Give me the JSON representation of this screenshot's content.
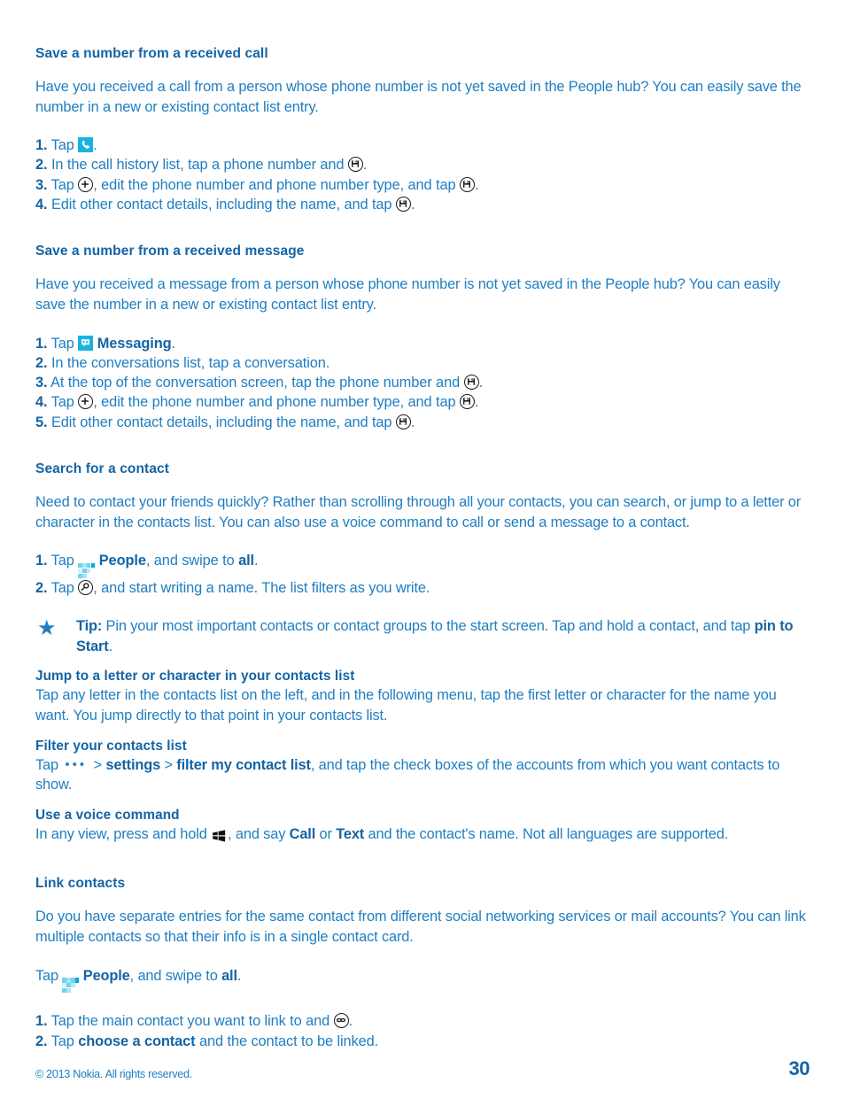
{
  "colors": {
    "heading": "#1464a5",
    "body": "#1f7ec2",
    "tile_cyan": "#16b4e0",
    "icon_outline": "#1a1a1a"
  },
  "sections": {
    "saved_call": {
      "title": "Save a number from a received call",
      "intro": "Have you received a call from a person whose phone number is not yet saved in the People hub? You can easily save the number in a new or existing contact list entry.",
      "steps": [
        {
          "num": "1.",
          "pre": "Tap ",
          "icon": "phone-tile-icon",
          "post": "."
        },
        {
          "num": "2.",
          "pre": "In the call history list, tap a phone number and ",
          "icon": "save-icon",
          "post": "."
        },
        {
          "num": "3.",
          "pre": "Tap ",
          "icon": "plus-icon",
          "mid": ", edit the phone number and phone number type, and tap ",
          "icon2": "save-icon",
          "post": "."
        },
        {
          "num": "4.",
          "pre": "Edit other contact details, including the name, and tap ",
          "icon": "save-icon",
          "post": "."
        }
      ]
    },
    "saved_message": {
      "title": "Save a number from a received message",
      "intro": "Have you received a message from a person whose phone number is not yet saved in the People hub? You can easily save the number in a new or existing contact list entry.",
      "steps": [
        {
          "num": "1.",
          "pre": "Tap ",
          "icon": "messaging-tile-icon",
          "bold": "Messaging",
          "post": "."
        },
        {
          "num": "2.",
          "pre": "In the conversations list, tap a conversation.",
          "post": ""
        },
        {
          "num": "3.",
          "pre": "At the top of the conversation screen, tap the phone number and ",
          "icon": "save-icon",
          "post": "."
        },
        {
          "num": "4.",
          "pre": "Tap ",
          "icon": "plus-icon",
          "mid": ", edit the phone number and phone number type, and tap ",
          "icon2": "save-icon",
          "post": "."
        },
        {
          "num": "5.",
          "pre": "Edit other contact details, including the name, and tap ",
          "icon": "save-icon",
          "post": "."
        }
      ]
    },
    "search_contact": {
      "title": "Search for a contact",
      "intro": "Need to contact your friends quickly? Rather than scrolling through all your contacts, you can search, or jump to a letter or character in the contacts list. You can also use a voice command to call or send a message to a contact.",
      "steps": [
        {
          "num": "1.",
          "pre": "Tap ",
          "icon": "people-tile-icon",
          "bold": "People",
          "mid": ", and swipe to ",
          "bold2": "all",
          "post": "."
        },
        {
          "num": "2.",
          "pre": "Tap ",
          "icon": "search-icon",
          "mid": ", and start writing a name. The list filters as you write.",
          "post": ""
        }
      ],
      "tip": {
        "label": "Tip:",
        "text_before": " Pin your most important contacts or contact groups to the start screen. Tap and hold a contact, and tap ",
        "bold": "pin to Start",
        "text_after": "."
      },
      "subsections": [
        {
          "title": "Jump to a letter or character in your contacts list",
          "text": "Tap any letter in the contacts list on the left, and in the following menu, tap the first letter or character for the name you want. You jump directly to that point in your contacts list."
        },
        {
          "title": "Filter your contacts list",
          "line_start": "Tap ",
          "menu_icon": "more-ellipsis-icon",
          "sep1": " > ",
          "bold1": "settings",
          "sep2": " > ",
          "bold2": "filter my contact list",
          "line_end": ", and tap the check boxes of the accounts from which you want contacts to show."
        },
        {
          "title": "Use a voice command",
          "line_start": "In any view, press and hold ",
          "win_icon": "windows-start-icon",
          "mid": ", and say ",
          "bold1": "Call",
          "sep": " or ",
          "bold2": "Text",
          "line_end": " and the contact's name. Not all languages are supported."
        }
      ]
    },
    "link_contacts": {
      "title": "Link contacts",
      "intro": "Do you have separate entries for the same contact from different social networking services or mail accounts? You can link multiple contacts so that their info is in a single contact card.",
      "tap_line": {
        "pre": "Tap ",
        "icon": "people-tile-icon",
        "bold": "People",
        "mid": ", and swipe to ",
        "bold2": "all",
        "post": "."
      },
      "steps": [
        {
          "num": "1.",
          "pre": "Tap the main contact you want to link to and ",
          "icon": "link-icon",
          "post": "."
        },
        {
          "num": "2.",
          "pre": "Tap ",
          "bold": "choose a contact",
          "mid": " and the contact to be linked.",
          "post": ""
        }
      ]
    }
  },
  "footer": {
    "copyright": "© 2013 Nokia. All rights reserved.",
    "page_number": "30"
  }
}
